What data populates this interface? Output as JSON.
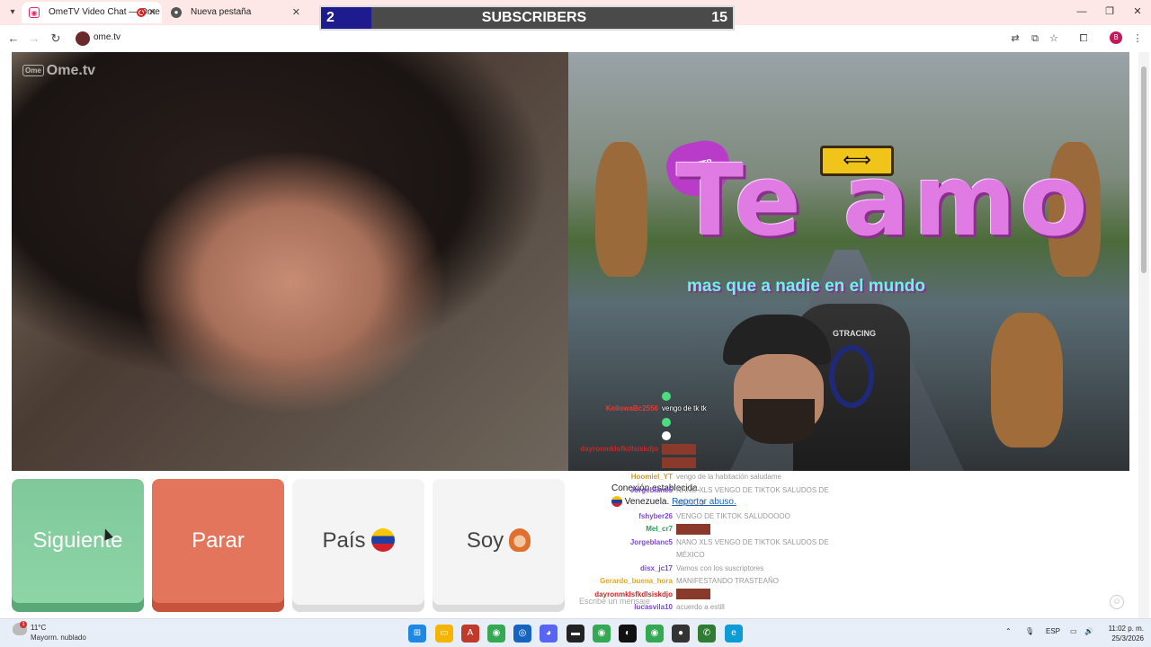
{
  "browser": {
    "tabs": [
      {
        "title": "OmeTV Video Chat — Ome",
        "active": true
      },
      {
        "title": "Nueva pestaña",
        "active": false
      }
    ],
    "url": "ome.tv",
    "profile_initial": "B"
  },
  "overlay": {
    "subscribers_count": "2",
    "subscribers_label": "SUBSCRIBERS",
    "subscribers_goal": "15"
  },
  "video_left": {
    "logo_badge": "Ome",
    "logo_text": "Ome.tv"
  },
  "video_right": {
    "heart_tag": "TUFTP",
    "headline": "Te amo",
    "subline": "mas que a nadie en el mundo",
    "chair_brand": "GTRACING",
    "overlay_chat": [
      {
        "user": "",
        "message": "",
        "color": "#2ecc71",
        "kind": "emote"
      },
      {
        "user": "KeilowaBc2556",
        "message": "vengo de tk tk",
        "color": "#e53935",
        "kind": "text"
      },
      {
        "user": "",
        "message": "",
        "color": "#2ecc71",
        "kind": "emote"
      },
      {
        "user": "",
        "message": "",
        "color": "#2ecc71",
        "kind": "emote"
      },
      {
        "user": "dayronmklsfkdlsiskdjo",
        "message": "",
        "color": "#c62828",
        "kind": "image"
      },
      {
        "user": "",
        "message": "",
        "color": "#2ecc71",
        "kind": "image"
      }
    ]
  },
  "controls": {
    "next_label": "Siguiente",
    "stop_label": "Parar",
    "country_label": "País",
    "iam_label": "Soy"
  },
  "chat": {
    "system_line1": "Conexión establecida.",
    "system_line2_prefix": "Venezuela.",
    "report_link": "Reportar abuso.",
    "input_placeholder": "Escribe un mensaje",
    "feed": [
      {
        "user": "Hoomiel_YT",
        "message": "vengo de la habitación saludame",
        "color": "#c89b3c"
      },
      {
        "user": "Jorgeblanc5",
        "message": "NANO XLS VENGO DE TIKTOK SALUDOS DE",
        "color": "#7b4bd3"
      },
      {
        "user": "",
        "message": "MÉXICO",
        "color": "#7b4bd3"
      },
      {
        "user": "fshyber26",
        "message": "VENGO DE TIKTOK SALUDOOOO",
        "color": "#7b4bd3"
      },
      {
        "user": "Mel_cr7",
        "message": "",
        "color": "#2e9c5a"
      },
      {
        "user": "Jorgeblanc5",
        "message": "NANO XLS VENGO DE TIKTOK SALUDOS DE",
        "color": "#7b4bd3"
      },
      {
        "user": "",
        "message": "MÉXICO",
        "color": "#7b4bd3"
      },
      {
        "user": "disx_jc17",
        "message": "Vamos con los suscriptores",
        "color": "#7b4bd3"
      },
      {
        "user": "Gerardo_buena_hora",
        "message": "MANIFESTANDO TRASTEAÑO",
        "color": "#e0a92b"
      },
      {
        "user": "dayronmklsfkdlsiskdjo",
        "message": "",
        "color": "#c62828"
      },
      {
        "user": "lucasvila10",
        "message": "acuerdo a estill",
        "color": "#7b4bd3"
      }
    ]
  },
  "taskbar": {
    "weather_temp": "11°C",
    "weather_desc": "Mayorm. nublado",
    "weather_badge": "1",
    "lang": "ESP",
    "time": "11:02 p. m.",
    "date": "25/3/2026"
  },
  "colors": {
    "next_green": "#8ed6a6",
    "stop_red": "#e3755c",
    "tab_bg": "#fde7e7",
    "subs_blue": "#1e1b8e"
  }
}
